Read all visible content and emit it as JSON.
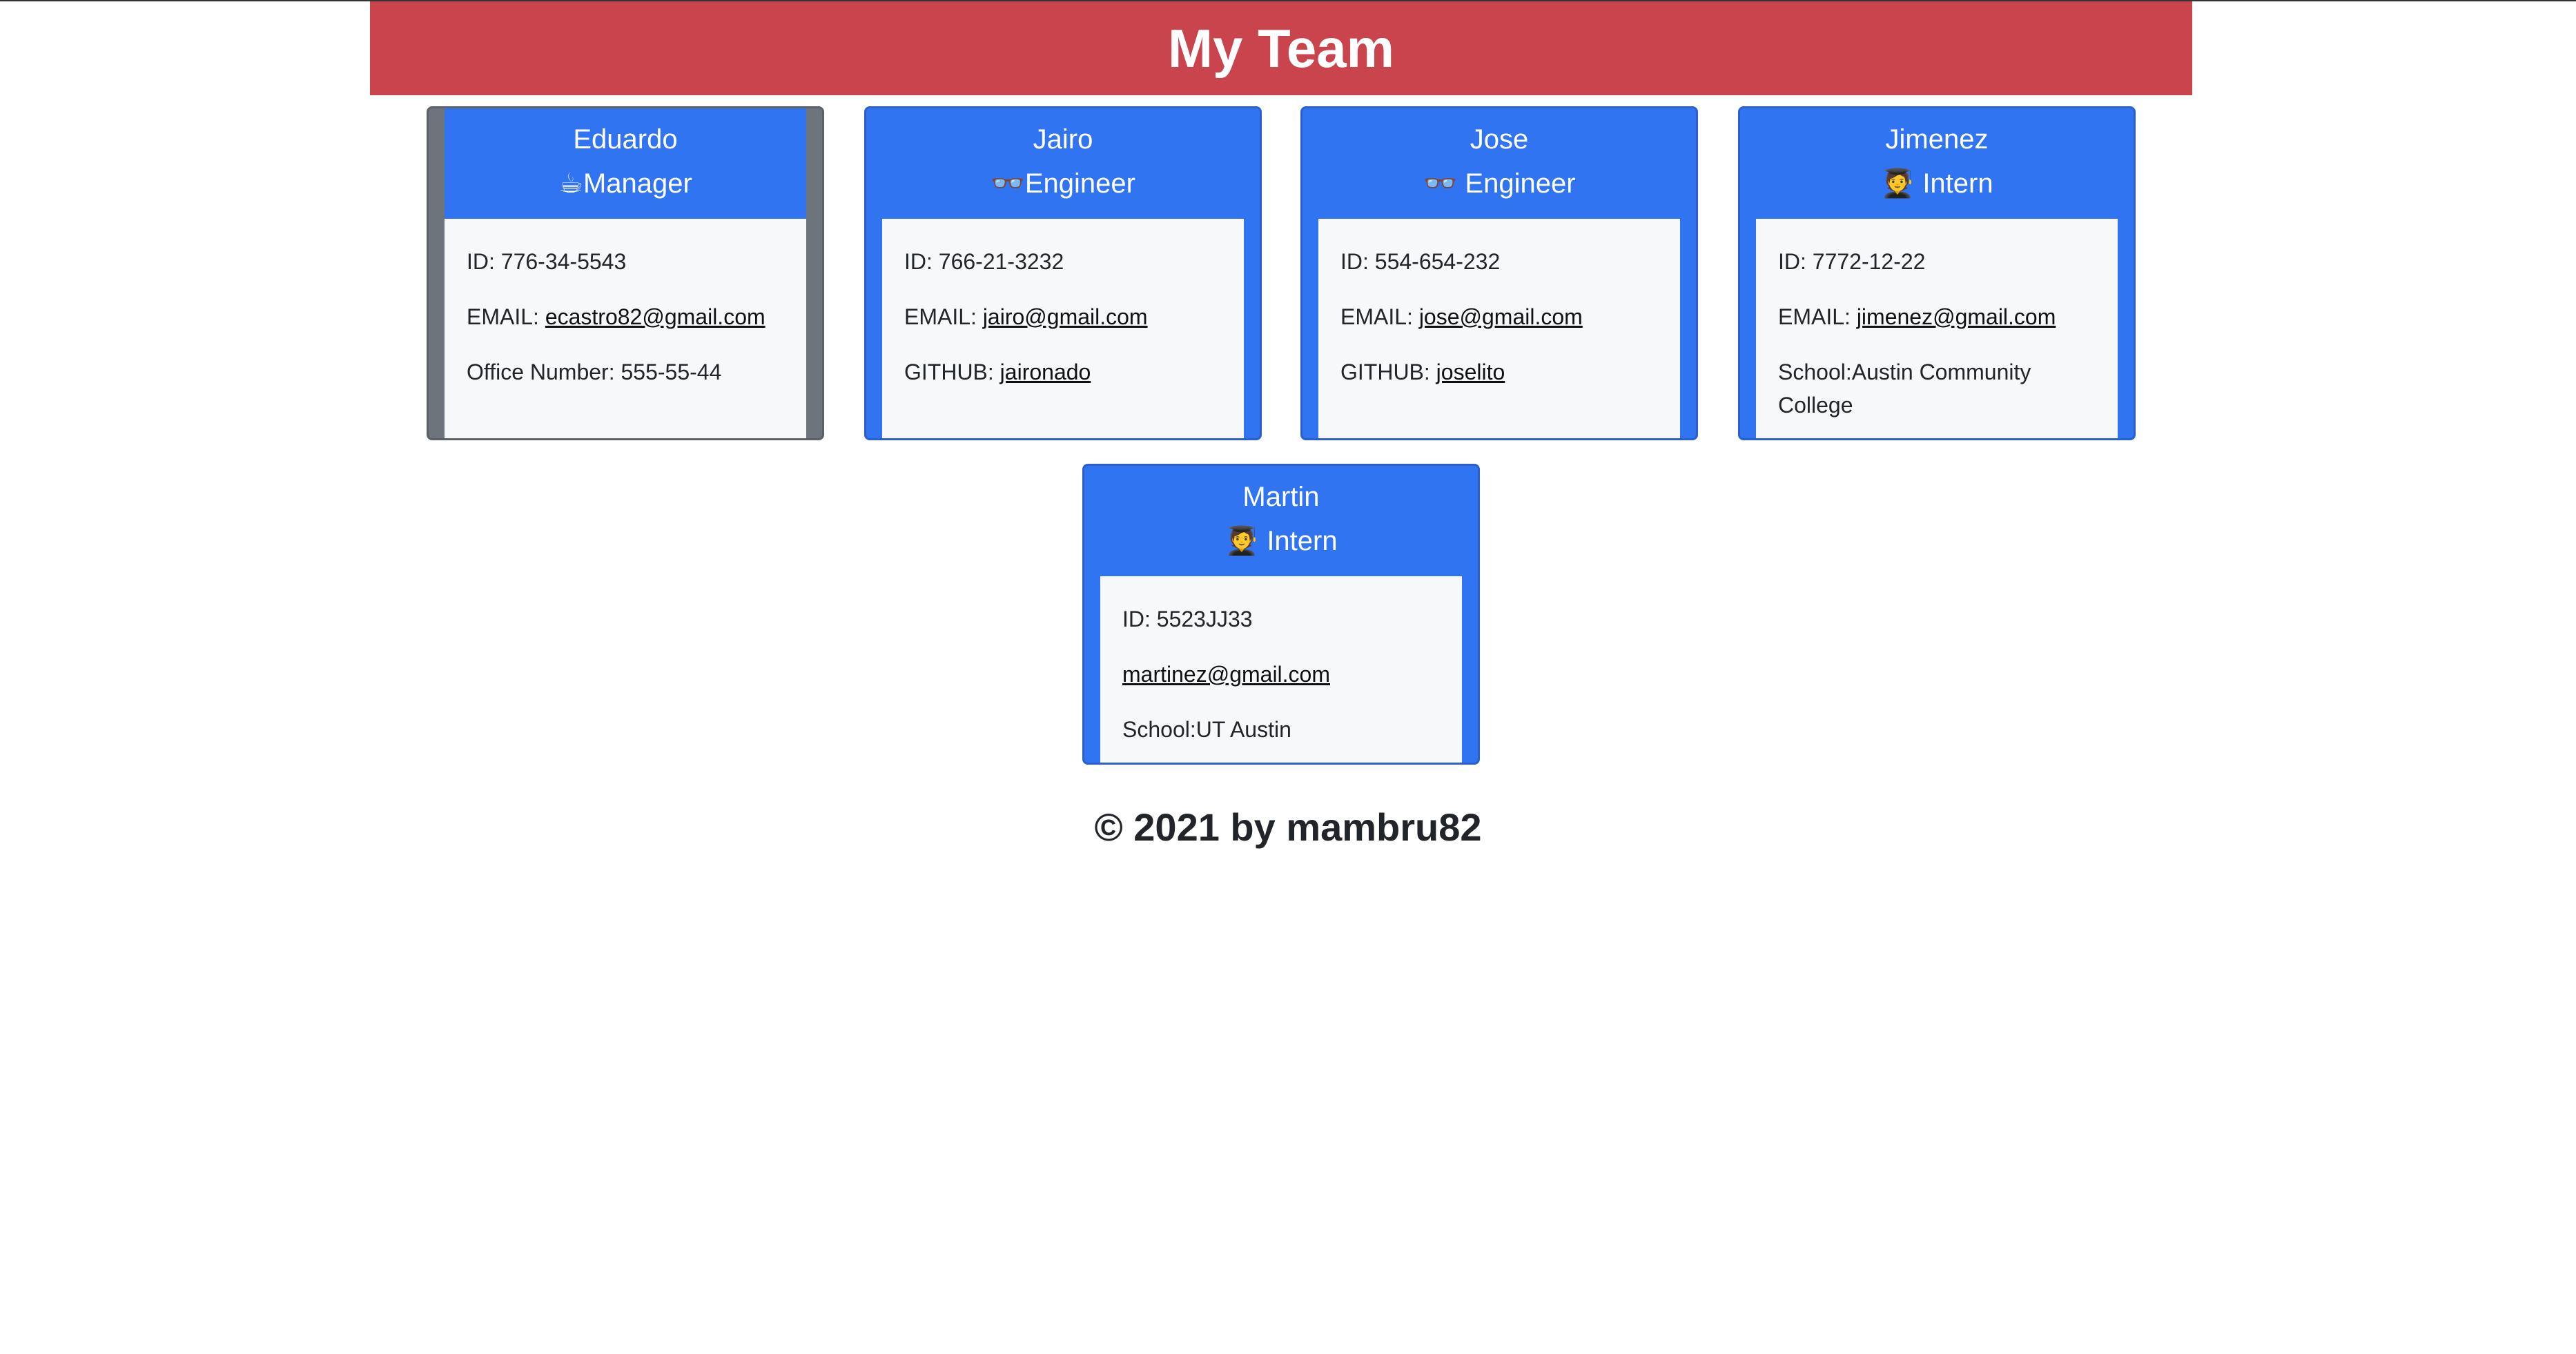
{
  "header": {
    "title": "My Team"
  },
  "cards": [
    {
      "name": "Eduardo",
      "role_icon": "☕",
      "role": "Manager",
      "id_line": "ID: 776-34-5543",
      "email_label": "EMAIL: ",
      "email": "ecastro82@gmail.com",
      "extra_line": "Office Number: 555-55-44"
    },
    {
      "name": "Jairo",
      "role_icon": "👓",
      "role": "Engineer",
      "id_line": "ID: 766-21-3232",
      "email_label": "EMAIL: ",
      "email": "jairo@gmail.com",
      "extra_label": "GITHUB: ",
      "extra_link": "jaironado"
    },
    {
      "name": "Jose",
      "role_icon": "👓",
      "role": " Engineer",
      "id_line": "ID: 554-654-232",
      "email_label": "EMAIL: ",
      "email": "jose@gmail.com",
      "extra_label": "GITHUB: ",
      "extra_link": "joselito"
    },
    {
      "name": "Jimenez",
      "role_icon": "🧑‍🎓",
      "role": " Intern",
      "id_line": "ID: 7772-12-22",
      "email_label": "EMAIL: ",
      "email": "jimenez@gmail.com",
      "extra_line": "School:Austin Community College"
    },
    {
      "name": "Martin",
      "role_icon": "🧑‍🎓",
      "role": " Intern",
      "id_line": "ID: 5523JJ33",
      "email": "martinez@gmail.com",
      "extra_line": "School:UT Austin"
    }
  ],
  "footer": {
    "text": "© 2021 by mambru82"
  },
  "colors": {
    "header_bg": "#ca444d",
    "card_blue": "#3074f1",
    "card_gray": "#6e747b",
    "card_body": "#f6f8fa"
  }
}
